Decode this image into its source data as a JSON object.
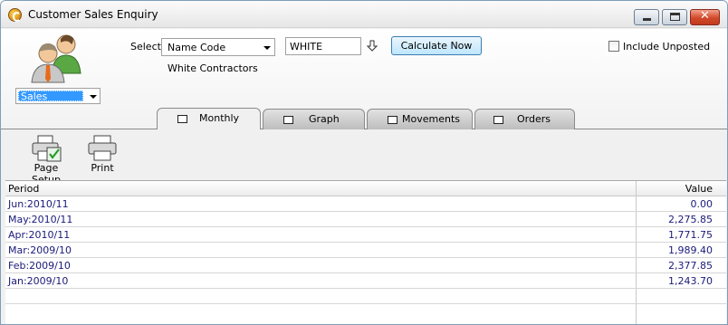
{
  "window": {
    "title": "Customer Sales Enquiry"
  },
  "toolbar": {
    "sales_dropdown": "Sales",
    "select_label": "Select:",
    "select_field": "Name Code",
    "search_value": "WHITE",
    "calculate_button": "Calculate Now",
    "customer_name": "White Contractors",
    "include_unposted_label": "Include Unposted",
    "include_unposted_checked": false
  },
  "tabs": [
    {
      "label": "Monthly",
      "icon": "monthly-icon",
      "active": true
    },
    {
      "label": "Graph",
      "icon": "graph-icon",
      "active": false
    },
    {
      "label": "Movements",
      "icon": "movements-icon",
      "active": false
    },
    {
      "label": "Orders",
      "icon": "orders-icon",
      "active": false
    }
  ],
  "actions": {
    "page_setup": "Page Setup",
    "print": "Print"
  },
  "table": {
    "columns": [
      "Period",
      "Value"
    ],
    "rows": [
      {
        "period": "Jun:2010/11",
        "value": "0.00"
      },
      {
        "period": "May:2010/11",
        "value": "2,275.85"
      },
      {
        "period": "Apr:2010/11",
        "value": "1,771.75"
      },
      {
        "period": "Mar:2009/10",
        "value": "1,989.40"
      },
      {
        "period": "Feb:2009/10",
        "value": "2,377.85"
      },
      {
        "period": "Jan:2009/10",
        "value": "1,243.70"
      }
    ]
  }
}
